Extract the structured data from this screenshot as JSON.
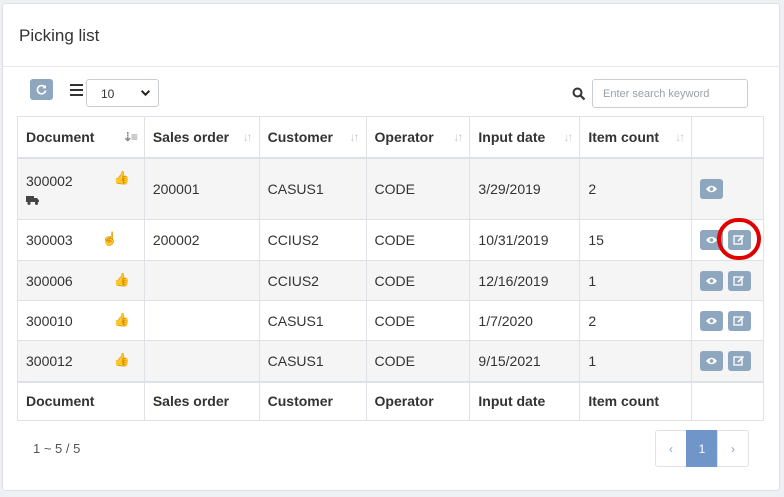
{
  "panel": {
    "title": "Picking list"
  },
  "toolbar": {
    "page_size": "10",
    "search_placeholder": "Enter search keyword"
  },
  "table": {
    "columns": [
      "Document",
      "Sales order",
      "Customer",
      "Operator",
      "Input date",
      "Item count"
    ],
    "rows": [
      {
        "document": "300002",
        "sales_order": "200001",
        "customer": "CASUS1",
        "operator": "CODE",
        "input_date": "3/29/2019",
        "item_count": "2",
        "icon": "hand-thumb-icon",
        "extra_icon": "truck-icon"
      },
      {
        "document": "300003",
        "sales_order": "200002",
        "customer": "CCIUS2",
        "operator": "CODE",
        "input_date": "10/31/2019",
        "item_count": "15",
        "icon": "hand-point-icon"
      },
      {
        "document": "300006",
        "sales_order": "",
        "customer": "CCIUS2",
        "operator": "CODE",
        "input_date": "12/16/2019",
        "item_count": "1",
        "icon": "hand-thumb-icon"
      },
      {
        "document": "300010",
        "sales_order": "",
        "customer": "CASUS1",
        "operator": "CODE",
        "input_date": "1/7/2020",
        "item_count": "2",
        "icon": "hand-thumb-icon"
      },
      {
        "document": "300012",
        "sales_order": "",
        "customer": "CASUS1",
        "operator": "CODE",
        "input_date": "9/15/2021",
        "item_count": "1",
        "icon": "hand-thumb-icon"
      }
    ]
  },
  "footer": {
    "range_text": "1 ~ 5 / 5",
    "pager": {
      "prev": "‹",
      "current": "1",
      "next": "›"
    }
  },
  "colors": {
    "accent": "#8fa6bf",
    "pager_active": "#6f95c9",
    "highlight": "#e00000"
  }
}
